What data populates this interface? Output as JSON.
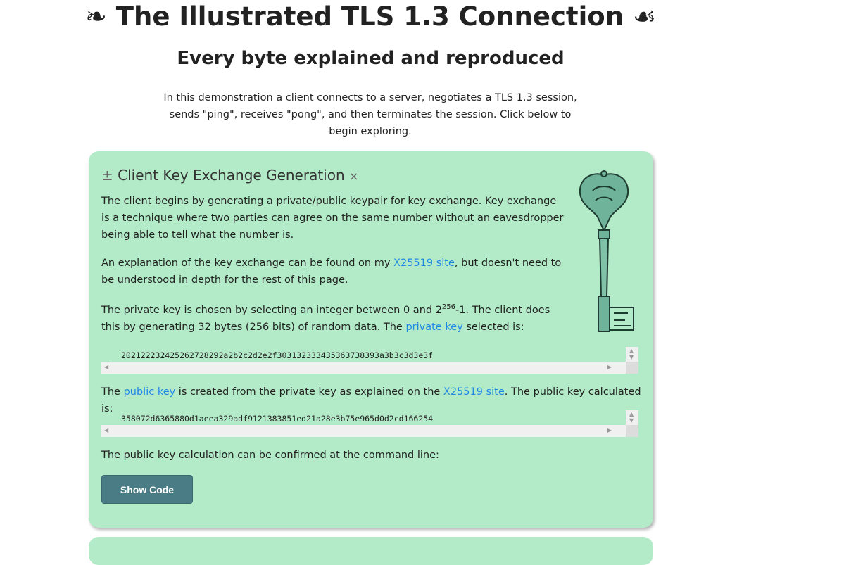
{
  "header": {
    "title": "❧ The Illustrated TLS 1.3 Connection ☙",
    "subtitle": "Every byte explained and reproduced",
    "intro": "In this demonstration a client connects to a server, negotiates a TLS 1.3 session, sends \"ping\", receives \"pong\", and then terminates the session. Click below to begin exploring."
  },
  "card": {
    "expand_icon": "±",
    "title": "Client Key Exchange Generation",
    "close_icon": "×",
    "p1": "The client begins by generating a private/public keypair for key exchange. Key exchange is a technique where two parties can agree on the same number without an eavesdropper being able to tell what the number is.",
    "p2_a": "An explanation of the key exchange can be found on my ",
    "p2_link": "X25519 site",
    "p2_b": ", but doesn't need to be understood in depth for the rest of this page.",
    "p3_a": "The private key is chosen by selecting an integer between 0 and 2",
    "p3_sup": "256",
    "p3_b": "-1. The client does this by generating 32 bytes (256 bits) of random data. The ",
    "p3_link": "private key",
    "p3_c": " selected is:",
    "private_key": "202122232425262728292a2b2c2d2e2f303132333435363738393a3b3c3d3e3f",
    "p4_a": "The ",
    "p4_link1": "public key",
    "p4_b": " is created from the private key as explained on the ",
    "p4_link2": "X25519 site",
    "p4_c": ". The public key calculated is:",
    "public_key": "358072d6365880d1aeea329adf9121383851ed21a28e3b75e965d0d2cd166254",
    "p5": "The public key calculation can be confirmed at the command line:",
    "show_code": "Show Code"
  },
  "colors": {
    "card_bg": "#b3ebc8",
    "link": "#1e88e5",
    "button": "#4a7c85"
  }
}
